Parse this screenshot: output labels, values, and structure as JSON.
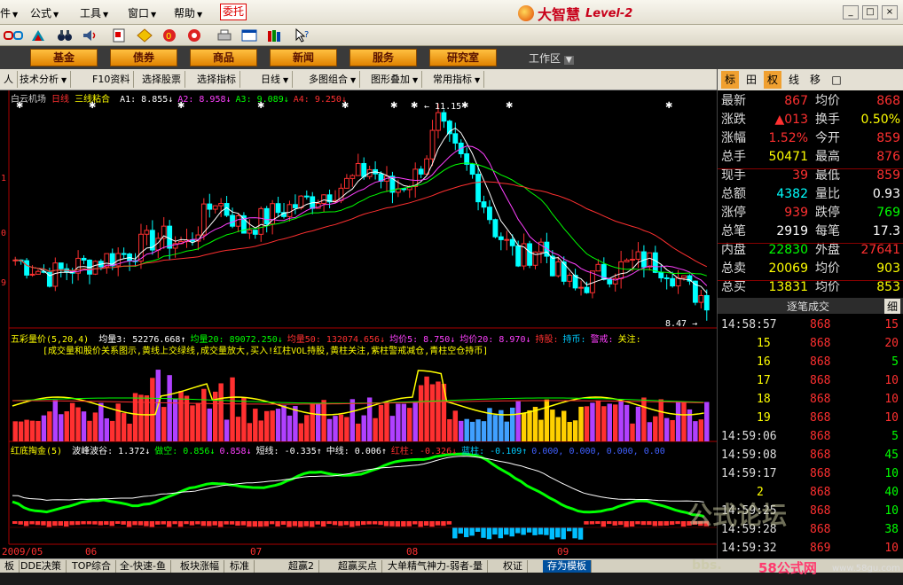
{
  "menu": {
    "items": [
      {
        "label": "件",
        "x": 6
      },
      {
        "label": "公式",
        "x": 34
      },
      {
        "label": "工具",
        "x": 90
      },
      {
        "label": "窗口",
        "x": 144
      },
      {
        "label": "帮助",
        "x": 196
      }
    ],
    "weituo": "委托",
    "brand": "大智慧",
    "brand_sub": "Level-2"
  },
  "nav": {
    "buttons": [
      "基金",
      "债券",
      "商品",
      "新闻",
      "服务",
      "研究室"
    ],
    "workarea": "工作区"
  },
  "subbar": {
    "items": [
      {
        "label": "人",
        "dd": false
      },
      {
        "label": "技术分析",
        "dd": true
      },
      {
        "label": "F10资料",
        "dd": false
      },
      {
        "label": "选择股票",
        "dd": false
      },
      {
        "label": "选择指标",
        "dd": false
      },
      {
        "label": "日线",
        "dd": true
      },
      {
        "label": "多图组合",
        "dd": true
      },
      {
        "label": "图形叠加",
        "dd": true
      },
      {
        "label": "常用指标",
        "dd": true
      }
    ]
  },
  "chart": {
    "title": "白云机场",
    "period": "日线",
    "indicator": "三线粘合",
    "ma": [
      {
        "label": "A1: 8.855↓",
        "color": "#ffffff"
      },
      {
        "label": "A2: 8.958↓",
        "color": "#ff40ff"
      },
      {
        "label": "A3: 9.089↓",
        "color": "#00ff00"
      },
      {
        "label": "A4: 9.250↓",
        "color": "#ff3030"
      }
    ],
    "high_label": "11.15",
    "low_label": "8.47",
    "y_ticks": [
      "1",
      "0",
      "9"
    ],
    "vol": {
      "name": "五彩量价(5,20,4)",
      "items": [
        {
          "label": "均量3: 52276.668↑",
          "color": "#ffffff"
        },
        {
          "label": "均量20: 89072.250↓",
          "color": "#00ff00"
        },
        {
          "label": "均量50: 132074.656↓",
          "color": "#ff3030"
        },
        {
          "label": "均价5: 8.750↓",
          "color": "#ff40ff"
        },
        {
          "label": "均价20: 8.970↓",
          "color": "#ff40ff"
        },
        {
          "label": "持股:",
          "color": "#ff3030"
        },
        {
          "label": "持币:",
          "color": "#00ccff"
        },
        {
          "label": "警戒:",
          "color": "#ff40ff"
        },
        {
          "label": "关注:",
          "color": "#ffff00"
        }
      ],
      "note": "[成交量和股价关系图示,黄线上交绿线,成交量放大,买入!红柱VOL持股,黄柱关注,紫柱警戒减仓,青柱空仓持币]"
    },
    "osc": {
      "name": "红底掏金(5)",
      "items": [
        {
          "label": "波峰波谷: 1.372↓",
          "color": "#ffffff"
        },
        {
          "label": "做空: 0.856↓",
          "color": "#00ff00"
        },
        {
          "label": "0.858↓",
          "color": "#ff40ff"
        },
        {
          "label": "短线: -0.335↑",
          "color": "#ffffff"
        },
        {
          "label": "中线: 0.006↑",
          "color": "#ffffff"
        },
        {
          "label": "红柱: -0.326↓",
          "color": "#ff3030"
        },
        {
          "label": "蓝柱: -0.109↑",
          "color": "#00ccff"
        },
        {
          "label": "0.000, 0.000, 0.000, 0.00",
          "color": "#4060ff"
        }
      ]
    },
    "dates": [
      "2009/05",
      "06",
      "07",
      "08",
      "09"
    ]
  },
  "quote": {
    "tabs": [
      "标",
      "田",
      "权",
      "线",
      "移",
      "□"
    ],
    "rows": [
      {
        "k1": "最新",
        "v1": "867",
        "c1": "#ff3030",
        "k2": "均价",
        "v2": "868",
        "c2": "#ff3030"
      },
      {
        "k1": "涨跌",
        "v1": "▲013",
        "c1": "#ff3030",
        "k2": "换手",
        "v2": "0.50%",
        "c2": "#ffff00"
      },
      {
        "k1": "涨幅",
        "v1": "1.52%",
        "c1": "#ff3030",
        "k2": "今开",
        "v2": "859",
        "c2": "#ff3030"
      },
      {
        "k1": "总手",
        "v1": "50471",
        "c1": "#ffff00",
        "k2": "最高",
        "v2": "876",
        "c2": "#ff3030"
      },
      {
        "k1": "现手",
        "v1": "39",
        "c1": "#ff3030",
        "k2": "最低",
        "v2": "859",
        "c2": "#ff3030"
      },
      {
        "k1": "总额",
        "v1": "4382",
        "c1": "#00ffff",
        "k2": "量比",
        "v2": "0.93",
        "c2": "#ffffff"
      },
      {
        "k1": "涨停",
        "v1": "939",
        "c1": "#ff3030",
        "k2": "跌停",
        "v2": "769",
        "c2": "#00ff00"
      },
      {
        "k1": "总笔",
        "v1": "2919",
        "c1": "#ffffff",
        "k2": "每笔",
        "v2": "17.3",
        "c2": "#ffffff"
      },
      {
        "k1": "内盘",
        "v1": "22830",
        "c1": "#00ff00",
        "k2": "外盘",
        "v2": "27641",
        "c2": "#ff3030"
      },
      {
        "k1": "总卖",
        "v1": "20069",
        "c1": "#ffff00",
        "k2": "均价",
        "v2": "903",
        "c2": "#ffff00"
      },
      {
        "k1": "总买",
        "v1": "13831",
        "c1": "#ffff00",
        "k2": "均价",
        "v2": "853",
        "c2": "#ffff00"
      }
    ],
    "zbcj_title": "逐笔成交",
    "zbcj_btn": "细",
    "trades": [
      {
        "t": "14:58:57",
        "p": "868",
        "v": "15"
      },
      {
        "t": "15",
        "p": "868",
        "v": "20"
      },
      {
        "t": "16",
        "p": "868",
        "v": "5"
      },
      {
        "t": "17",
        "p": "868",
        "v": "10"
      },
      {
        "t": "18",
        "p": "868",
        "v": "10"
      },
      {
        "t": "19",
        "p": "868",
        "v": "10"
      },
      {
        "t": "14:59:06",
        "p": "868",
        "v": "5"
      },
      {
        "t": "14:59:08",
        "p": "868",
        "v": "45"
      },
      {
        "t": "14:59:17",
        "p": "868",
        "v": "10"
      },
      {
        "t": "2",
        "p": "868",
        "v": "40"
      },
      {
        "t": "14:59:25",
        "p": "868",
        "v": "10"
      },
      {
        "t": "14:59:28",
        "p": "868",
        "v": "38"
      },
      {
        "t": "14:59:32",
        "p": "869",
        "v": "10"
      },
      {
        "t": "14:59:??",
        "p": "???",
        "v": "??"
      }
    ]
  },
  "status": {
    "items": [
      "板",
      "DDE决策",
      "TOP综合",
      "全-快速-鱼",
      "板块涨幅",
      "标准",
      "超赢2",
      "超赢买点",
      "大单精气神力-弱者-量",
      "权证",
      "存为模板"
    ],
    "active": 10
  },
  "watermark": {
    "main": "公式论坛",
    "site_prefix": "bbs.",
    "site": "58公式网",
    "url": "www.58gu.com"
  }
}
